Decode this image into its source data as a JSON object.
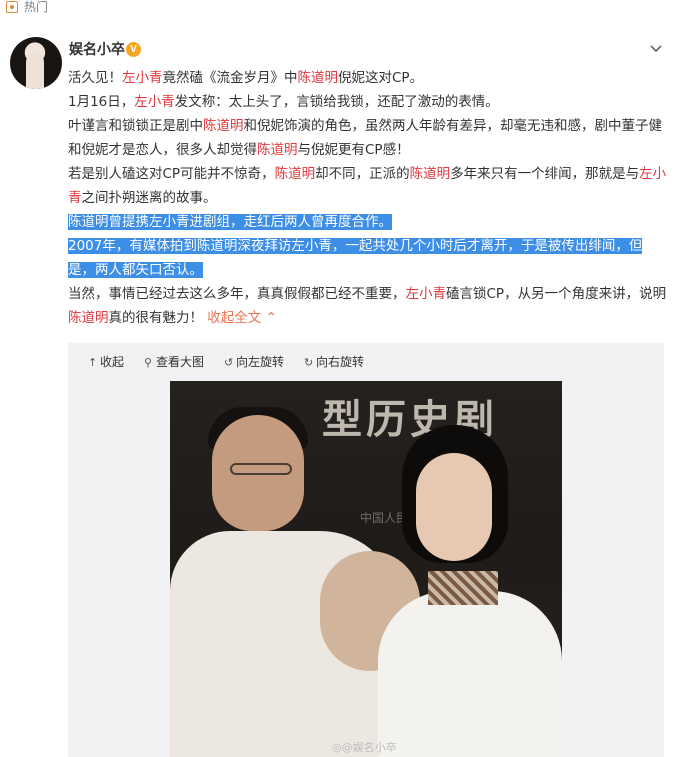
{
  "header": {
    "hot_label": "热门"
  },
  "author": {
    "name": "娱名小卒",
    "badge": "V"
  },
  "post": {
    "p1": {
      "a": "活久见！",
      "hl1": "左小青",
      "b": "竟然磕《流金岁月》中",
      "hl2": "陈道明",
      "c": "倪妮这对CP。"
    },
    "p2": {
      "a": "1月16日，",
      "hl1": "左小青",
      "b": "发文称：太上头了，言锁给我锁，还配了激动的表情。"
    },
    "p3": {
      "a": "叶谨言和锁锁正是剧中",
      "hl1": "陈道明",
      "b": "和倪妮饰演的角色，虽然两人年龄有差异，却毫无违和感，剧中董子健和倪妮才是恋人，很多人却觉得",
      "hl2": "陈道明",
      "c": "与倪妮更有CP感！"
    },
    "p4": {
      "a": "若是别人磕这对CP可能并不惊奇，",
      "hl1": "陈道明",
      "b": "却不同，正派的",
      "hl2": "陈道明",
      "c": "多年来只有一个绯闻，那就是与",
      "hl3": "左小青",
      "d": "之间扑朔迷离的故事。"
    },
    "p5": "陈道明曾提携左小青进剧组，走红后两人曾再度合作。",
    "p6": "2007年，有媒体拍到陈道明深夜拜访左小青，一起共处几个小时后才离开，于是被传出绯闻，但是，两人都矢口否认。",
    "p7": {
      "a": "当然，事情已经过去这么多年，真真假假都已经不重要，",
      "hl1": "左小青",
      "b": "磕言锁CP，从另一个角度来讲，说明",
      "hl2": "陈道明",
      "c": "真的很有魅力！",
      "more": "收起全文"
    }
  },
  "media_toolbar": {
    "collapse": "收起",
    "view_large": "查看大图",
    "rotate_left": "向左旋转",
    "rotate_right": "向右旋转"
  },
  "photo": {
    "banner_text": "型历史剧",
    "banner_small": "中国人民解放军区",
    "watermark": "@娱名小卒"
  },
  "colors": {
    "highlight": "#e0383e",
    "selection": "#3d8ee6",
    "link": "#eb7350",
    "badge": "#f5a623"
  }
}
